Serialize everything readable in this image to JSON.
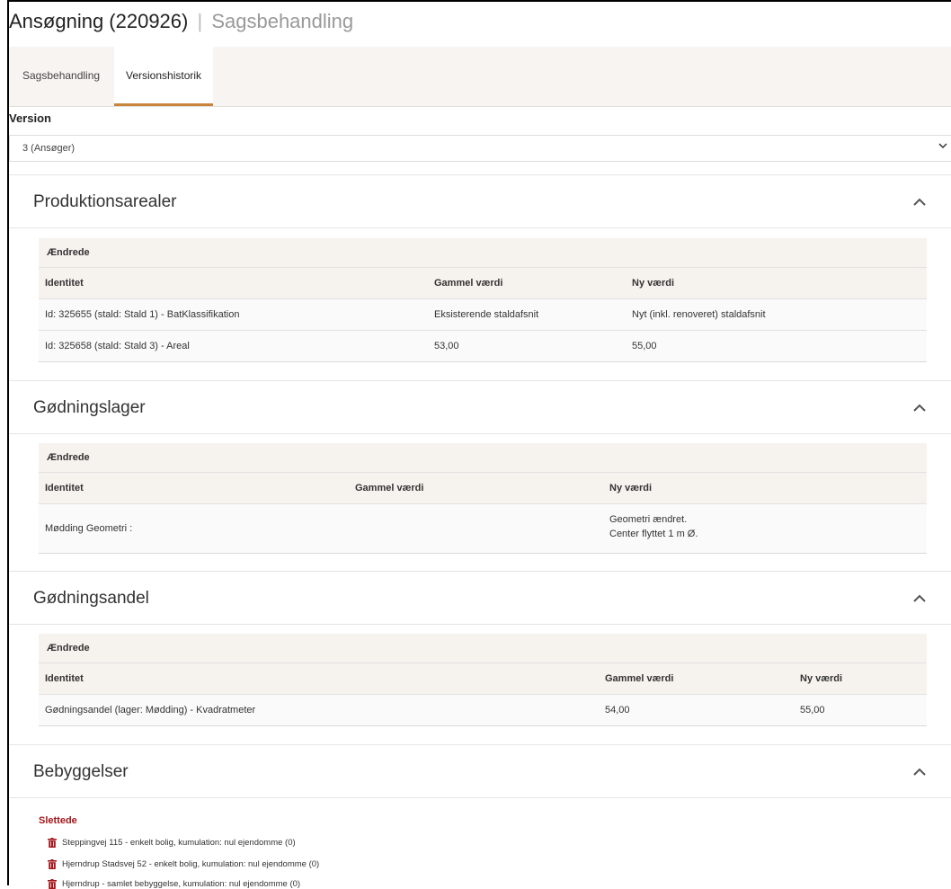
{
  "header": {
    "title": "Ansøgning (220926)",
    "separator": "|",
    "subtitle": "Sagsbehandling"
  },
  "tabs": [
    {
      "label": "Sagsbehandling",
      "active": false
    },
    {
      "label": "Versionshistorik",
      "active": true
    }
  ],
  "version": {
    "label": "Version",
    "selected": "3 (Ansøger)"
  },
  "sections": {
    "produktionsarealer": {
      "title": "Produktionsarealer",
      "changed_label": "Ændrede",
      "columns": [
        "Identitet",
        "Gammel værdi",
        "Ny værdi"
      ],
      "rows": [
        [
          "Id: 325655 (stald: Stald 1) - BatKlassifikation",
          "Eksisterende staldafsnit",
          "Nyt (inkl. renoveret) staldafsnit"
        ],
        [
          "Id: 325658 (stald: Stald 3) - Areal",
          "53,00",
          "55,00"
        ]
      ]
    },
    "godningslager": {
      "title": "Gødningslager",
      "changed_label": "Ændrede",
      "columns": [
        "Identitet",
        "Gammel værdi",
        "Ny værdi"
      ],
      "rows": [
        [
          "Mødding Geometri :",
          "",
          "Geometri ændret.",
          "Center flyttet 1 m Ø."
        ]
      ]
    },
    "godningsandel": {
      "title": "Gødningsandel",
      "changed_label": "Ændrede",
      "columns": [
        "Identitet",
        "Gammel værdi",
        "Ny værdi"
      ],
      "rows": [
        [
          "Gødningsandel (lager: Mødding) - Kvadratmeter",
          "54,00",
          "55,00"
        ]
      ]
    },
    "bebyggelser": {
      "title": "Bebyggelser",
      "deleted_label": "Slettede",
      "deleted": [
        "Steppingvej 115 - enkelt bolig, kumulation: nul ejendomme (0)",
        "Hjerndrup Stadsvej 52 - enkelt bolig, kumulation: nul ejendomme (0)",
        "Hjerndrup - samlet bebyggelse, kumulation: nul ejendomme (0)"
      ]
    }
  },
  "icons": {
    "toggle": "chevron-up-icon",
    "select": "chevron-down-icon",
    "delete": "trash-icon"
  },
  "colors": {
    "tab_active": "#c8843a",
    "deleted": "#a4161a",
    "header_bg": "#f6f2ee"
  }
}
